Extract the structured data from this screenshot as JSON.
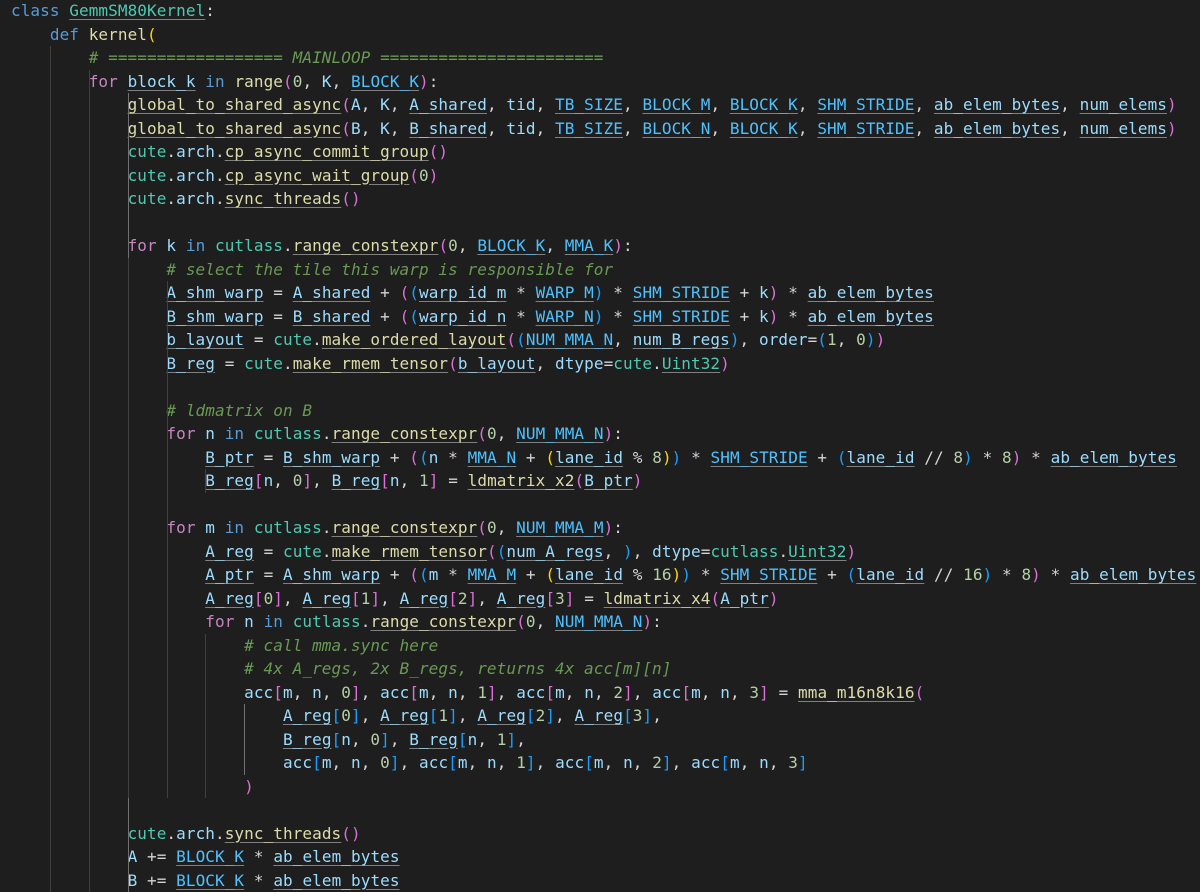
{
  "editor": {
    "colors": {
      "background": "#1e1e1e",
      "keyword": "#569cd6",
      "control": "#c586c0",
      "class": "#4ec9b0",
      "function": "#dcdcaa",
      "variable": "#9cdcfe",
      "constant": "#4fc1ff",
      "comment": "#6a9955",
      "bracket_1": "#ffd700",
      "bracket_2": "#da70d6",
      "bracket_3": "#179fff"
    },
    "lines": [
      "class GemmSM80Kernel:",
      "    def kernel(",
      "        # ================== MAINLOOP =======================",
      "        for block_k in range(0, K, BLOCK_K):",
      "            global_to_shared_async(A, K, A_shared, tid, TB_SIZE, BLOCK_M, BLOCK_K, SHM_STRIDE, ab_elem_bytes, num_elems)",
      "            global_to_shared_async(B, K, B_shared, tid, TB_SIZE, BLOCK_N, BLOCK_K, SHM_STRIDE, ab_elem_bytes, num_elems)",
      "            cute.arch.cp_async_commit_group()",
      "            cute.arch.cp_async_wait_group(0)",
      "            cute.arch.sync_threads()",
      "",
      "            for k in cutlass.range_constexpr(0, BLOCK_K, MMA_K):",
      "                # select the tile this warp is responsible for",
      "                A_shm_warp = A_shared + ((warp_id_m * WARP_M) * SHM_STRIDE + k) * ab_elem_bytes",
      "                B_shm_warp = B_shared + ((warp_id_n * WARP_N) * SHM_STRIDE + k) * ab_elem_bytes",
      "                b_layout = cute.make_ordered_layout((NUM_MMA_N, num_B_regs), order=(1, 0))",
      "                B_reg = cute.make_rmem_tensor(b_layout, dtype=cute.Uint32)",
      "",
      "                # ldmatrix on B",
      "                for n in cutlass.range_constexpr(0, NUM_MMA_N):",
      "                    B_ptr = B_shm_warp + ((n * MMA_N + (lane_id % 8)) * SHM_STRIDE + (lane_id // 8) * 8) * ab_elem_bytes",
      "                    B_reg[n, 0], B_reg[n, 1] = ldmatrix_x2(B_ptr)",
      "",
      "                for m in cutlass.range_constexpr(0, NUM_MMA_M):",
      "                    A_reg = cute.make_rmem_tensor((num_A_regs, ), dtype=cutlass.Uint32)",
      "                    A_ptr = A_shm_warp + ((m * MMA_M + (lane_id % 16)) * SHM_STRIDE + (lane_id // 16) * 8) * ab_elem_bytes",
      "                    A_reg[0], A_reg[1], A_reg[2], A_reg[3] = ldmatrix_x4(A_ptr)",
      "                    for n in cutlass.range_constexpr(0, NUM_MMA_N):",
      "                        # call mma.sync here",
      "                        # 4x A_regs, 2x B_regs, returns 4x acc[m][n]",
      "                        acc[m, n, 0], acc[m, n, 1], acc[m, n, 2], acc[m, n, 3] = mma_m16n8k16(",
      "                            A_reg[0], A_reg[1], A_reg[2], A_reg[3],",
      "                            B_reg[n, 0], B_reg[n, 1],",
      "                            acc[m, n, 0], acc[m, n, 1], acc[m, n, 2], acc[m, n, 3]",
      "                        )",
      "",
      "            cute.arch.sync_threads()",
      "            A += BLOCK_K * ab_elem_bytes",
      "            B += BLOCK_K * ab_elem_bytes"
    ]
  }
}
